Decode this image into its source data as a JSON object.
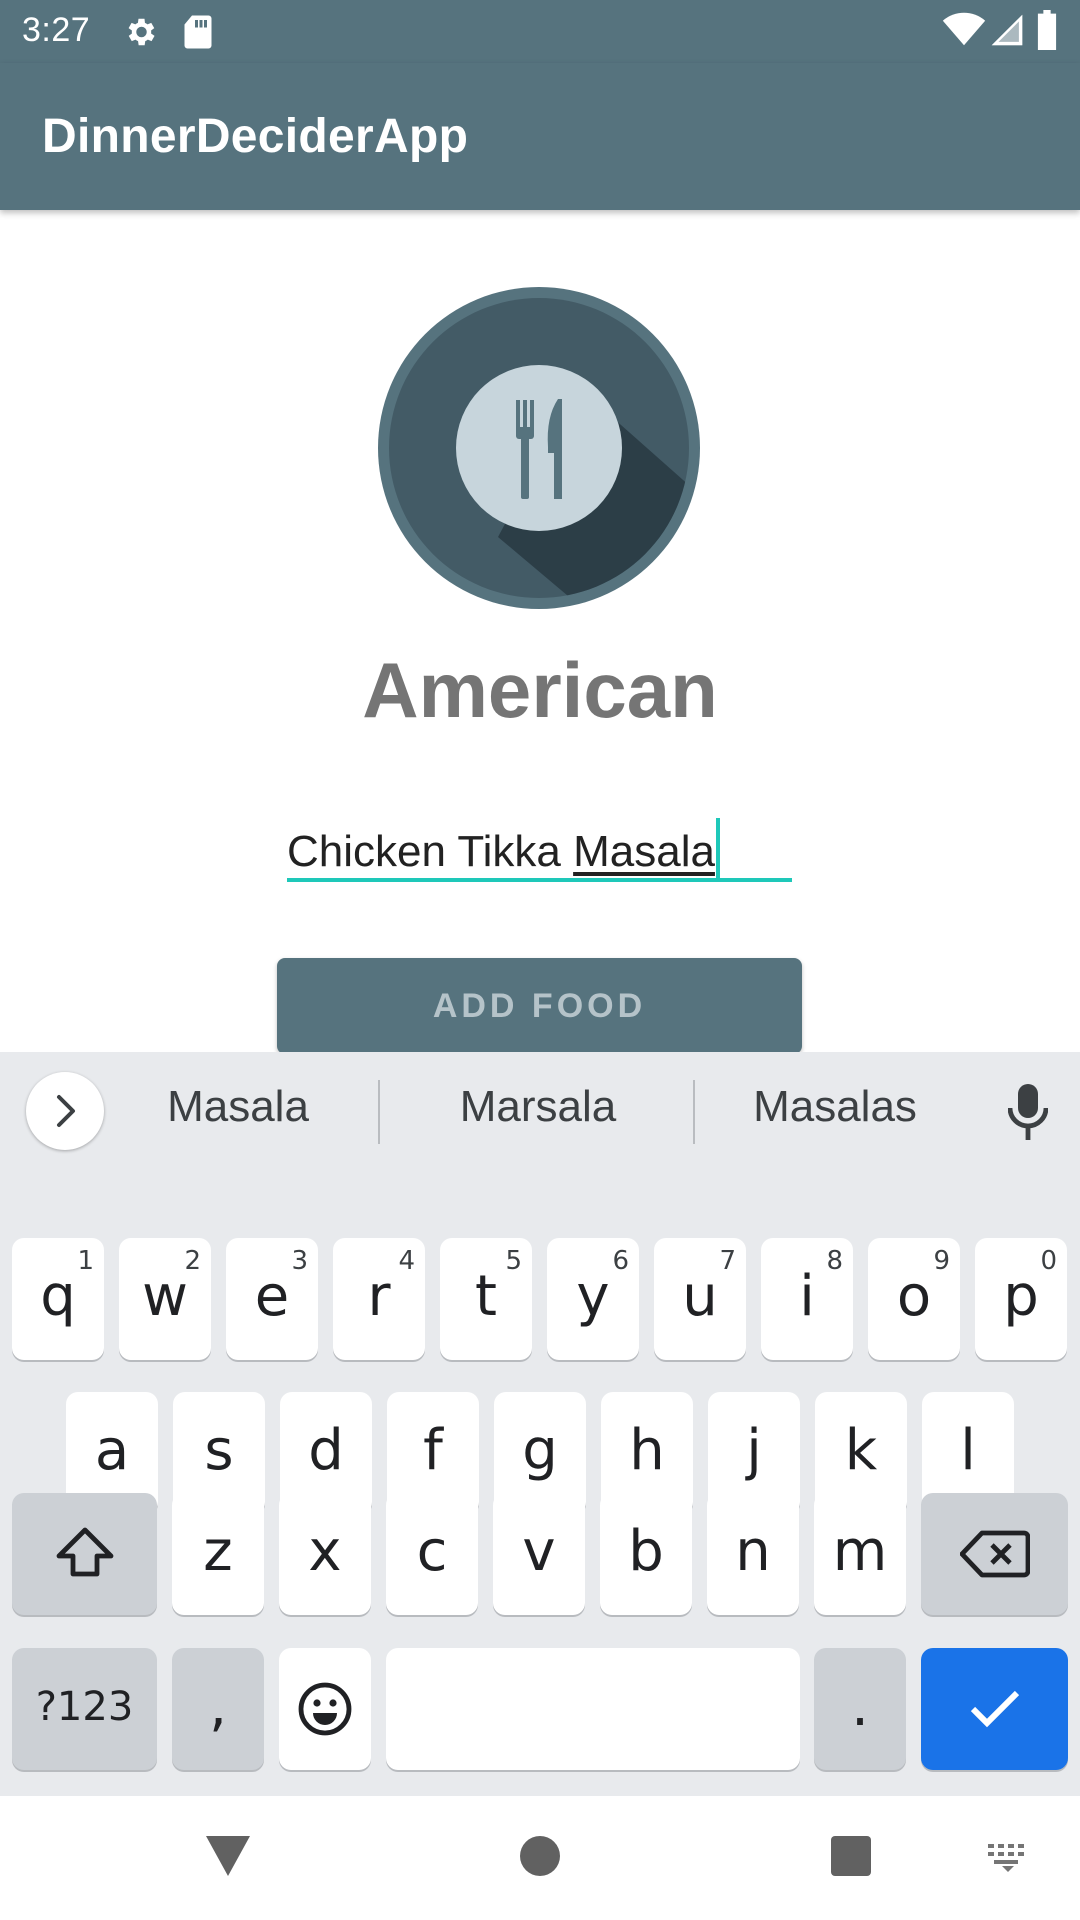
{
  "status_bar": {
    "time": "3:27",
    "icons_left": [
      "gear-icon",
      "sd-card-icon"
    ],
    "icons_right": [
      "wifi-icon",
      "signal-icon",
      "battery-icon"
    ]
  },
  "app_bar": {
    "title": "DinnerDeciderApp"
  },
  "main": {
    "logo_icon": "fork-knife-plate-icon",
    "cuisine": "American",
    "food_input": {
      "value_plain": "Chicken Tikka ",
      "value_composing": "Masala"
    },
    "add_button_label": "ADD FOOD"
  },
  "keyboard": {
    "suggestions": [
      "Masala",
      "Marsala",
      "Masalas"
    ],
    "row1": [
      {
        "k": "q",
        "h": "1"
      },
      {
        "k": "w",
        "h": "2"
      },
      {
        "k": "e",
        "h": "3"
      },
      {
        "k": "r",
        "h": "4"
      },
      {
        "k": "t",
        "h": "5"
      },
      {
        "k": "y",
        "h": "6"
      },
      {
        "k": "u",
        "h": "7"
      },
      {
        "k": "i",
        "h": "8"
      },
      {
        "k": "o",
        "h": "9"
      },
      {
        "k": "p",
        "h": "0"
      }
    ],
    "row2": [
      "a",
      "s",
      "d",
      "f",
      "g",
      "h",
      "j",
      "k",
      "l"
    ],
    "row3": [
      "z",
      "x",
      "c",
      "v",
      "b",
      "n",
      "m"
    ],
    "symbols_label": "?123",
    "comma_label": ",",
    "period_label": ".",
    "accent_color": "#1a73e8"
  },
  "nav_bar": {
    "icons": [
      "back-icon",
      "home-icon",
      "recents-icon",
      "keyboard-switch-icon"
    ]
  },
  "colors": {
    "primary": "#56737e",
    "accent": "#1ec8b9",
    "cuisine_text": "#757575"
  }
}
